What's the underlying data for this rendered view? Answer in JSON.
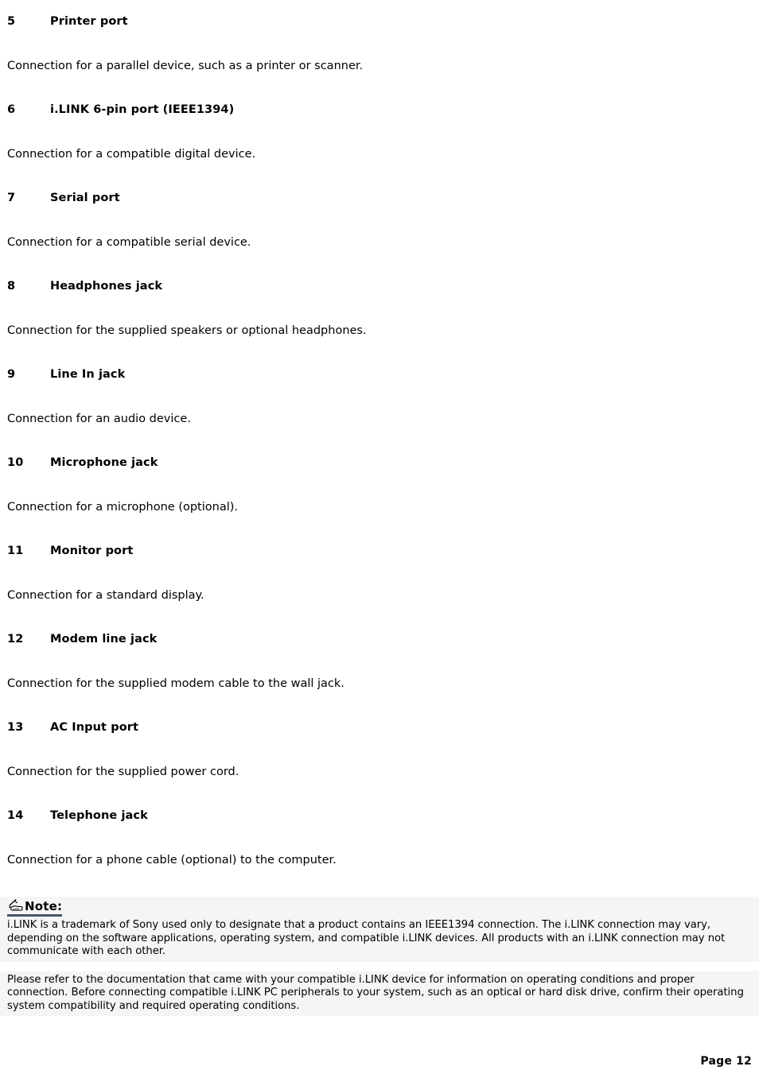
{
  "document": {
    "entries": [
      {
        "num": "5",
        "label": "Printer port",
        "desc": "Connection for a parallel device, such as a printer or scanner."
      },
      {
        "num": "6",
        "label": "i.LINK 6-pin port (IEEE1394)",
        "desc": "Connection for a compatible digital device."
      },
      {
        "num": "7",
        "label": "Serial port",
        "desc": "Connection for a compatible serial device."
      },
      {
        "num": "8",
        "label": "Headphones jack",
        "desc": "Connection for the supplied speakers or optional headphones."
      },
      {
        "num": "9",
        "label": "Line In jack",
        "desc": "Connection for an audio device."
      },
      {
        "num": "10",
        "label": "Microphone jack",
        "desc": "Connection for a microphone (optional)."
      },
      {
        "num": "11",
        "label": "Monitor port",
        "desc": "Connection for a standard display."
      },
      {
        "num": "12",
        "label": "Modem line jack",
        "desc": "Connection for the supplied modem cable to the wall jack."
      },
      {
        "num": "13",
        "label": "AC Input port",
        "desc": "Connection for the supplied power cord."
      },
      {
        "num": "14",
        "label": "Telephone jack",
        "desc": "Connection for a phone cable (optional) to the computer."
      }
    ],
    "note": {
      "icon": "writing-hand-pen-icon",
      "title": "Note:",
      "paragraphs": [
        "i.LINK is a trademark of Sony used only to designate that a product contains an IEEE1394 connection. The i.LINK connection may vary, depending on the software applications, operating system, and compatible i.LINK devices. All products with an i.LINK connection may not communicate with each other.",
        "Please refer to the documentation that came with your compatible i.LINK device for information on operating conditions and proper connection. Before connecting compatible i.LINK PC peripherals to your system, such as an optical or hard disk drive, confirm their operating system compatibility and required operating conditions."
      ],
      "accent_color": "#46556b",
      "background_color": "#f5f5f5"
    },
    "footer": {
      "page_label": "Page 12"
    }
  }
}
